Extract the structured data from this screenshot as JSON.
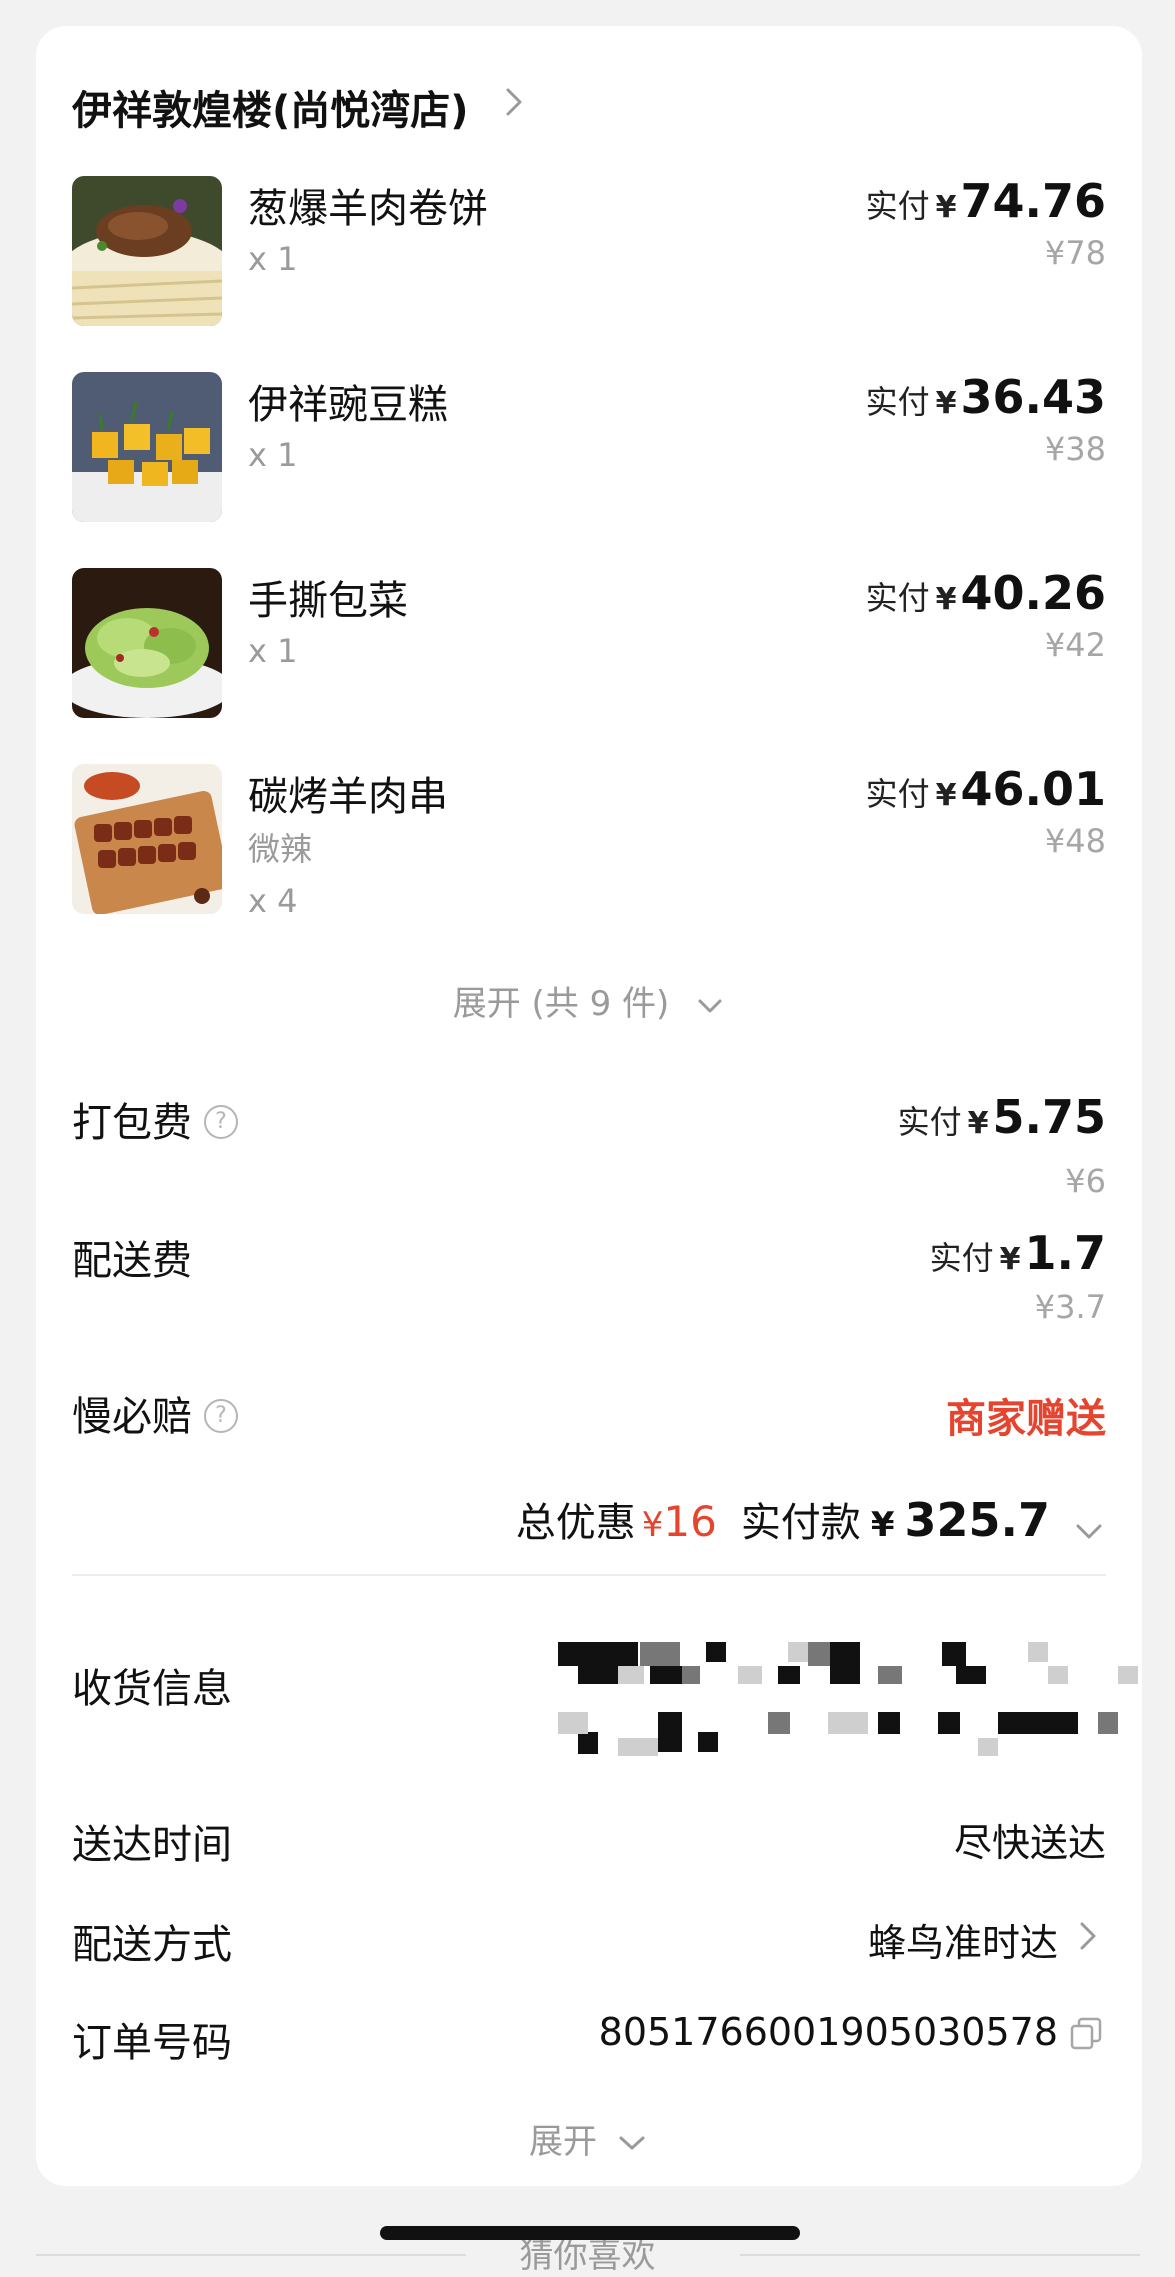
{
  "shop": {
    "name": "伊祥敦煌楼(尚悦湾店)"
  },
  "items": [
    {
      "name": "葱爆羊肉卷饼",
      "spec": "",
      "qty": "x 1",
      "paid_label": "实付",
      "yen": "¥",
      "paid": "74.76",
      "original": "¥78",
      "icon": "lamb-wrap-photo"
    },
    {
      "name": "伊祥豌豆糕",
      "spec": "",
      "qty": "x 1",
      "paid_label": "实付",
      "yen": "¥",
      "paid": "36.43",
      "original": "¥38",
      "icon": "pea-cake-photo"
    },
    {
      "name": "手撕包菜",
      "spec": "",
      "qty": "x 1",
      "paid_label": "实付",
      "yen": "¥",
      "paid": "40.26",
      "original": "¥42",
      "icon": "cabbage-photo"
    },
    {
      "name": "碳烤羊肉串",
      "spec": "微辣",
      "qty": "x 4",
      "paid_label": "实付",
      "yen": "¥",
      "paid": "46.01",
      "original": "¥48",
      "icon": "lamb-skewer-photo"
    }
  ],
  "expand_items": "展开 (共 9 件)",
  "fees": {
    "packaging": {
      "label": "打包费",
      "paid_label": "实付",
      "yen": "¥",
      "paid": "5.75",
      "original": "¥6"
    },
    "delivery": {
      "label": "配送费",
      "paid_label": "实付",
      "yen": "¥",
      "paid": "1.7",
      "original": "¥3.7"
    },
    "late_guarantee": {
      "label": "慢必赔",
      "value": "商家赠送"
    }
  },
  "summary": {
    "discount_label": "总优惠",
    "discount_yen": "¥",
    "discount": "16",
    "paid_label": "实付款",
    "paid_yen": "¥",
    "paid": "325.7"
  },
  "info": {
    "receiver_label": "收货信息",
    "time_label": "送达时间",
    "time_value": "尽快送达",
    "method_label": "配送方式",
    "method_value": "蜂鸟准时达",
    "order_label": "订单号码",
    "order_value": "8051766001905030578"
  },
  "expand_more": "展开",
  "footer": {
    "guess": "猜你喜欢"
  },
  "colors": {
    "accent_red": "#e5442e",
    "muted": "#9a9a9a",
    "card": "#ffffff",
    "background": "#f2f2f2"
  }
}
